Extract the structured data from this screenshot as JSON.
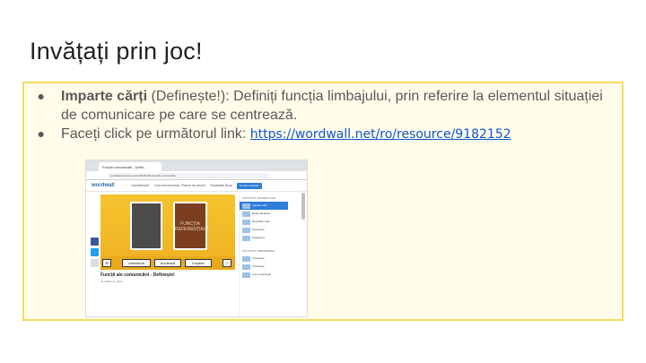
{
  "slide": {
    "title": "Invățați prin joc!",
    "bullets": [
      {
        "bold": "Imparte cărți",
        "rest": " (Definește!): Definiți funcția limbajului,  prin referire la elementul situației de comunicare pe care se centrează."
      },
      {
        "prefix": "Faceți click pe următorul link: ",
        "link": "https://wordwall.net/ro/resource/9182152"
      }
    ],
    "bullet_symbol": "●"
  },
  "screenshot": {
    "tab_title": "Functii comunicarii - Defin...",
    "url": "wordwall.net/ro/resource/9182152/funcțiile-comunicării",
    "logo": "wordwall",
    "nav_items": [
      "Caracteristici",
      "Cum funcționează",
      "Planuri de preturi",
      "Fiscalitate Noua"
    ],
    "create_button": "Creare Activitate",
    "card_text": "FUNCȚIA REFERENȚIALĂ",
    "game_buttons": [
      "Amestecă",
      "Anulează",
      "Imparte"
    ],
    "activity_title": "Funcții ale comunicării - Definește!",
    "activity_meta": "de Liliana D. Sirbu",
    "side_head_1": "ACTIVITĂȚI INTERACTIVE",
    "side_items": [
      "Imparte cărți",
      "Roata aleatorie",
      "Deschide cutia",
      "Cartonașe",
      "Anagrama"
    ],
    "side_head_2": "ACTIVITĂȚI IMPRIMABILE",
    "side_items_2": [
      "Cartonașe",
      "Cartonașe",
      "Lucru individual"
    ]
  },
  "colors": {
    "box_border": "#f3dc63",
    "box_fill": "#fffcea",
    "link": "#1155cc",
    "game_yellow": "#f5c42f"
  }
}
